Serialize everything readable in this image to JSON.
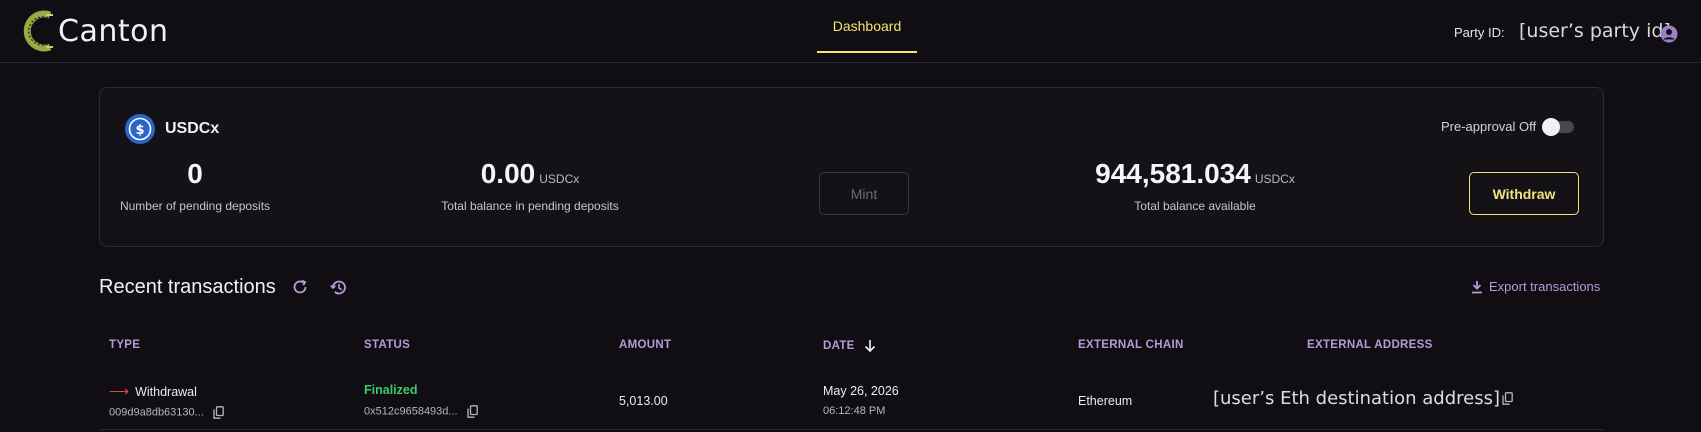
{
  "app": {
    "name": "Canton"
  },
  "nav": {
    "tabs": [
      {
        "label": "Dashboard",
        "active": true
      }
    ]
  },
  "header": {
    "party_label": "Party ID:",
    "party_value": "[user’s party id]",
    "user_icon": "account-circle-icon"
  },
  "card": {
    "token_name": "USDCx",
    "token_icon": "usdc-dollar-icon",
    "pending_count": "0",
    "pending_count_label": "Number of pending deposits",
    "pending_balance": "0.00",
    "pending_balance_unit": "USDCx",
    "pending_balance_label": "Total balance in pending deposits",
    "mint_label": "Mint",
    "available_balance": "944,581.034",
    "available_balance_unit": "USDCx",
    "available_balance_label": "Total balance available",
    "withdraw_label": "Withdraw",
    "preapproval_label": "Pre-approval Off",
    "preapproval_on": false
  },
  "transactions": {
    "title": "Recent transactions",
    "export_label": "Export transactions",
    "columns": [
      "TYPE",
      "STATUS",
      "AMOUNT",
      "DATE",
      "EXTERNAL CHAIN",
      "EXTERNAL ADDRESS"
    ],
    "rows": [
      {
        "type": "Withdrawal",
        "type_id": "009d9a8db63130...",
        "status": "Finalized",
        "status_id": "0x512c9658493d...",
        "amount": "5,013.00",
        "date": "May 26, 2026",
        "time": "06:12:48 PM",
        "chain": "Ethereum",
        "address": "[user’s Eth destination address]"
      }
    ]
  },
  "colors": {
    "background": "#110e13",
    "accent_yellow": "#f0e56e",
    "accent_purple": "#b59cd6",
    "status_green": "#3ec96a",
    "withdraw_red": "#e0463f"
  }
}
